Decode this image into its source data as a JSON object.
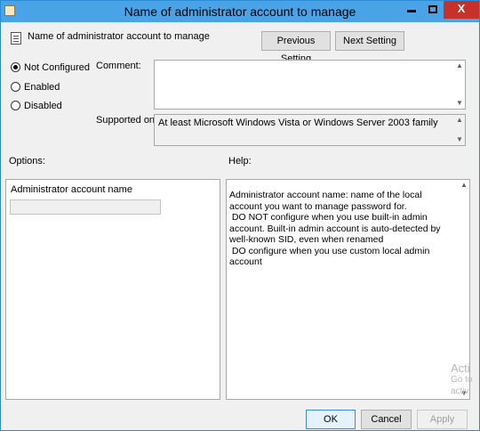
{
  "window": {
    "title": "Name of administrator account to manage",
    "minimize_icon": "minimize-icon",
    "maximize_icon": "maximize-icon",
    "close_label": "X"
  },
  "header": {
    "setting_name": "Name of administrator account to manage",
    "previous_label": "Previous Setting",
    "next_label": "Next Setting"
  },
  "state": {
    "options": [
      {
        "label": "Not Configured",
        "checked": true
      },
      {
        "label": "Enabled",
        "checked": false
      },
      {
        "label": "Disabled",
        "checked": false
      }
    ]
  },
  "comment": {
    "label": "Comment:",
    "value": ""
  },
  "supported": {
    "label": "Supported on:",
    "value": "At least Microsoft Windows Vista or Windows Server 2003 family"
  },
  "options_panel": {
    "label": "Options:",
    "field_label": "Administrator account name",
    "field_value": ""
  },
  "help_panel": {
    "label": "Help:",
    "lines": [
      "Administrator account name: name of the local account you want to manage password for.",
      " DO NOT configure when you use built-in admin account. Built-in admin account is auto-detected by well-known SID, even when renamed",
      "",
      " DO configure when you use custom local admin account"
    ]
  },
  "footer": {
    "ok_label": "OK",
    "cancel_label": "Cancel",
    "apply_label": "Apply"
  },
  "watermark": {
    "line1": "Acti",
    "line2": "Go to",
    "line3": "activ"
  }
}
